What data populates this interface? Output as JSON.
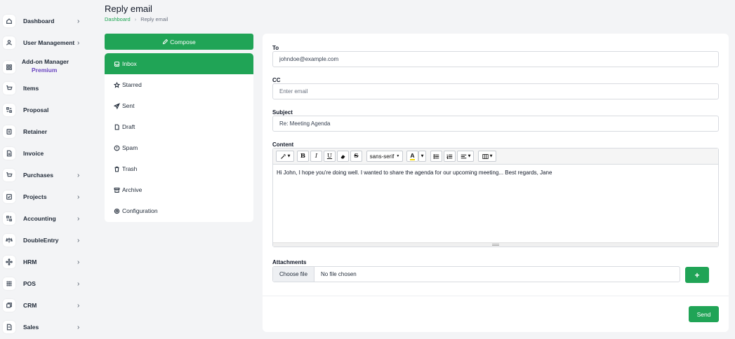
{
  "sidebar": {
    "items": [
      {
        "label": "Dashboard",
        "icon": "home-icon",
        "chevron": true
      },
      {
        "label": "User Management",
        "icon": "users-icon",
        "chevron": true
      },
      {
        "label": "Add-on Manager",
        "badge": "Premium",
        "icon": "grid-icon",
        "chevron": false
      },
      {
        "label": "Items",
        "icon": "cart-icon",
        "chevron": false
      },
      {
        "label": "Proposal",
        "icon": "proposal-icon",
        "chevron": false
      },
      {
        "label": "Retainer",
        "icon": "retainer-icon",
        "chevron": false
      },
      {
        "label": "Invoice",
        "icon": "invoice-icon",
        "chevron": false
      },
      {
        "label": "Purchases",
        "icon": "cart-icon",
        "chevron": true
      },
      {
        "label": "Projects",
        "icon": "projects-icon",
        "chevron": true
      },
      {
        "label": "Accounting",
        "icon": "accounting-icon",
        "chevron": true
      },
      {
        "label": "DoubleEntry",
        "icon": "scale-icon",
        "chevron": true
      },
      {
        "label": "HRM",
        "icon": "hrm-icon",
        "chevron": true
      },
      {
        "label": "POS",
        "icon": "pos-icon",
        "chevron": true
      },
      {
        "label": "CRM",
        "icon": "crm-icon",
        "chevron": true
      },
      {
        "label": "Sales",
        "icon": "sales-icon",
        "chevron": true
      }
    ]
  },
  "header": {
    "title": "Reply email",
    "breadcrumb": [
      "Dashboard",
      "Reply email"
    ]
  },
  "mail_nav": {
    "compose_label": "Compose",
    "items": [
      {
        "label": "Inbox",
        "icon": "inbox-icon",
        "active": true
      },
      {
        "label": "Starred",
        "icon": "star-icon",
        "active": false
      },
      {
        "label": "Sent",
        "icon": "send-icon",
        "active": false
      },
      {
        "label": "Draft",
        "icon": "file-icon",
        "active": false
      },
      {
        "label": "Spam",
        "icon": "alert-icon",
        "active": false
      },
      {
        "label": "Trash",
        "icon": "trash-icon",
        "active": false
      },
      {
        "label": "Archive",
        "icon": "archive-icon",
        "active": false
      },
      {
        "label": "Configuration",
        "icon": "gear-icon",
        "active": false
      }
    ]
  },
  "form": {
    "to_label": "To",
    "to_value": "johndoe@example.com",
    "cc_label": "CC",
    "cc_placeholder": "Enter email",
    "subject_label": "Subject",
    "subject_value": "Re: Meeting Agenda",
    "content_label": "Content",
    "content_text": "Hi John, I hope you're doing well. I wanted to share the agenda for our upcoming meeting... Best regards, Jane",
    "toolbar": {
      "bold": "B",
      "italic": "I",
      "underline": "U",
      "strike": "S",
      "font": "sans-serif",
      "color_letter": "A"
    },
    "attachments_label": "Attachments",
    "choose_file_label": "Choose file",
    "no_file_label": "No file chosen",
    "add_label": "+",
    "send_label": "Send"
  },
  "colors": {
    "accent": "#20a456",
    "premium": "#6b46c1"
  }
}
